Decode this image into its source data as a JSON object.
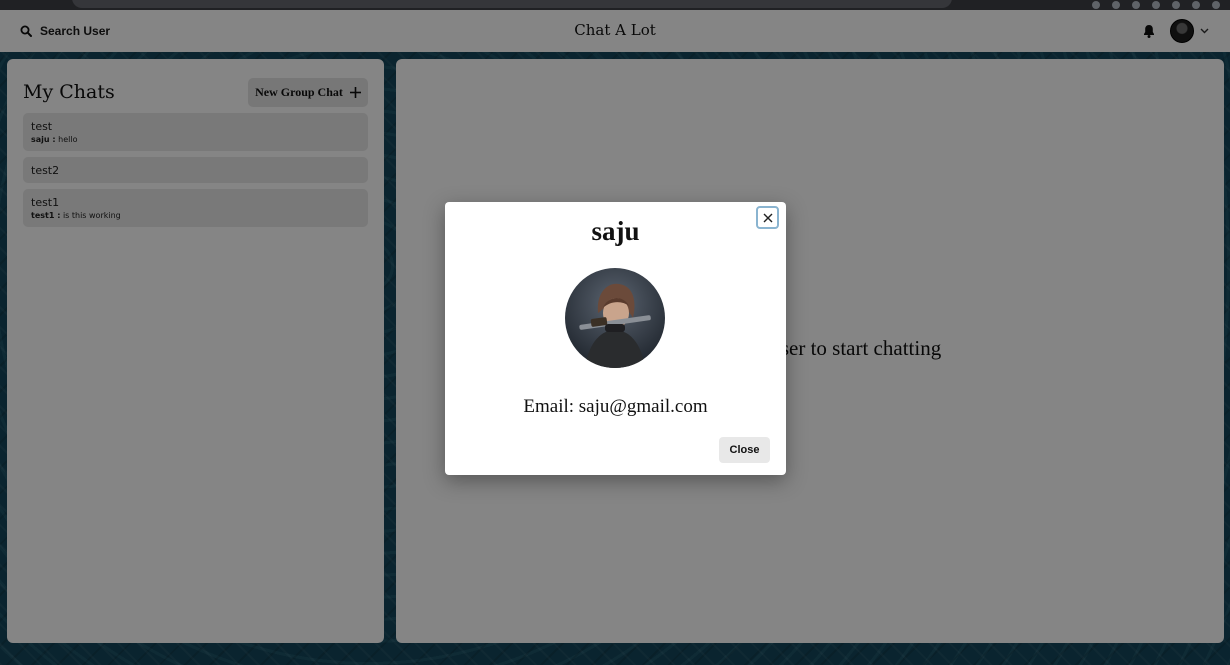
{
  "header": {
    "search_label": "Search User",
    "app_title": "Chat A Lot",
    "icons": [
      "search-icon",
      "bell-icon",
      "chevron-down-icon"
    ]
  },
  "sidebar": {
    "title": "My Chats",
    "new_group_label": "New Group Chat",
    "chats": [
      {
        "name": "test",
        "sender": "saju :",
        "message": "hello"
      },
      {
        "name": "test2",
        "sender": "",
        "message": ""
      },
      {
        "name": "test1",
        "sender": "test1 :",
        "message": "is this working"
      }
    ]
  },
  "main": {
    "empty_message": "Click on a user to start chatting"
  },
  "modal": {
    "title": "saju",
    "email": "Email: saju@gmail.com",
    "close_label": "Close"
  }
}
